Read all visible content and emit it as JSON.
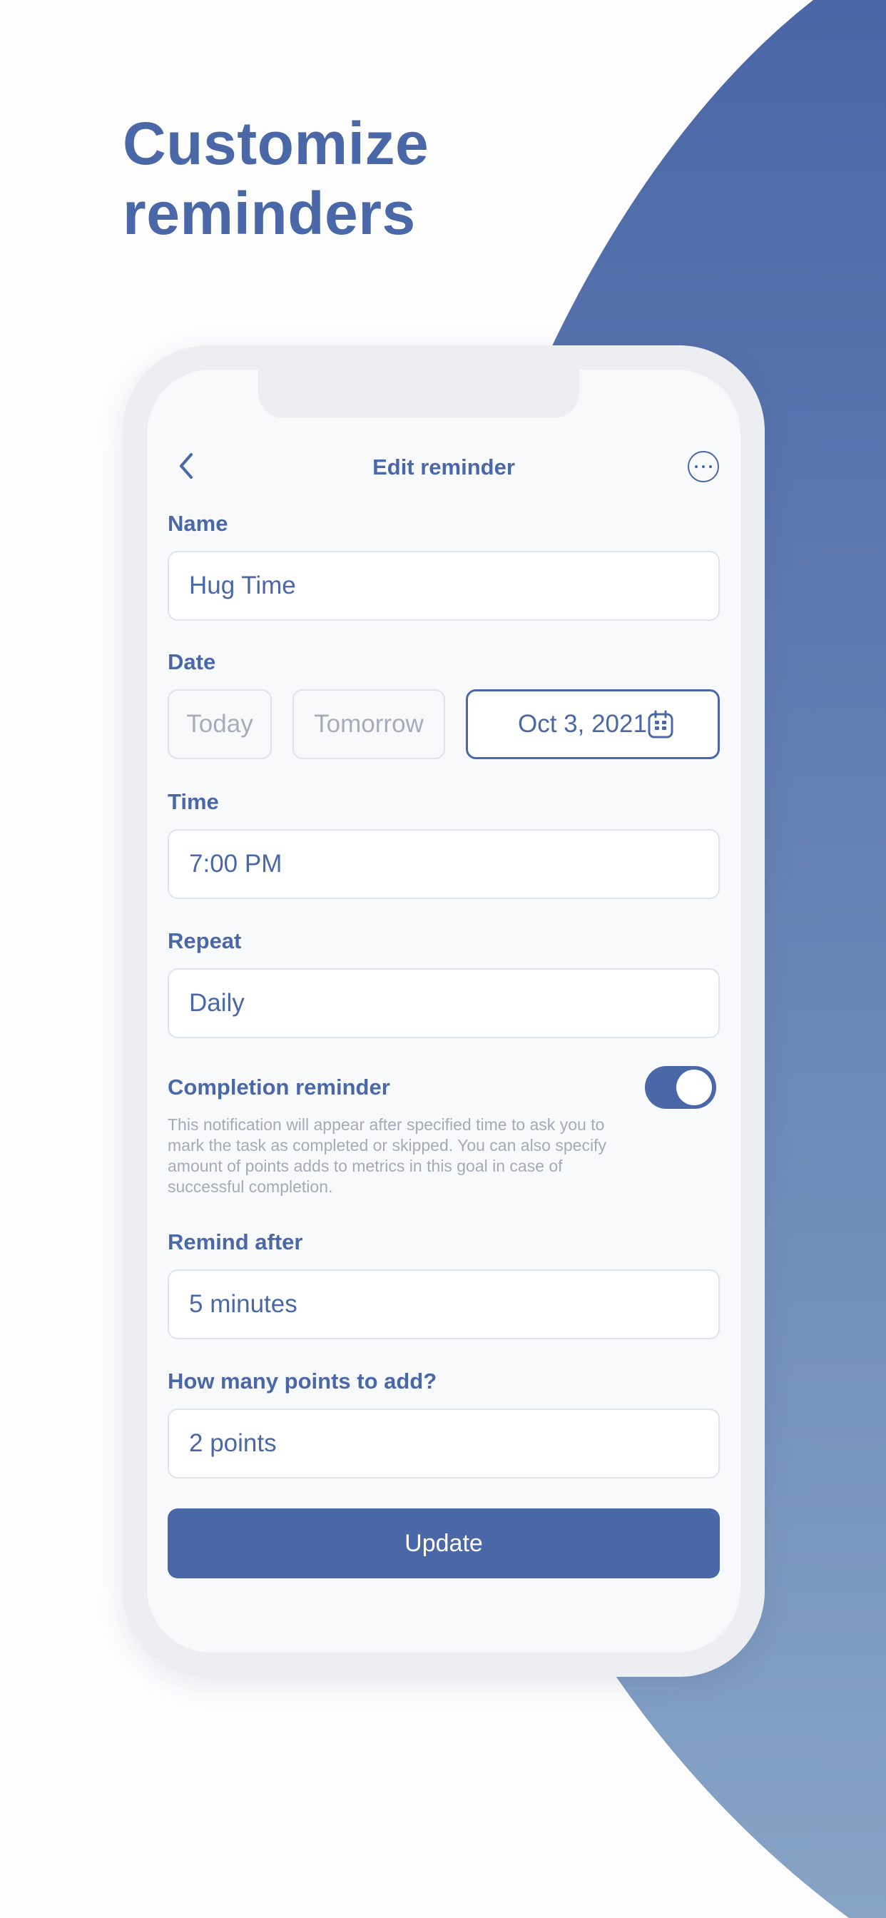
{
  "headline": {
    "line1": "Customize",
    "line2": "reminders"
  },
  "colors": {
    "accent": "#4a67a7",
    "muted_text": "#a4abb6",
    "border": "#dfe3ea"
  },
  "nav": {
    "title": "Edit reminder",
    "back_icon": "chevron-left-icon",
    "more_icon": "more-horizontal-icon"
  },
  "name": {
    "label": "Name",
    "value": "Hug Time"
  },
  "date": {
    "label": "Date",
    "options": [
      "Today",
      "Tomorrow"
    ],
    "selected": "Oct 3, 2021",
    "selected_icon": "calendar-icon"
  },
  "time": {
    "label": "Time",
    "value": "7:00 PM"
  },
  "repeat": {
    "label": "Repeat",
    "value": "Daily"
  },
  "completion": {
    "label": "Completion reminder",
    "enabled": true,
    "helper": "This notification will appear after specified time to ask you to mark the task as completed or skipped. You can also specify amount of points adds to metrics in this goal in case of successful completion."
  },
  "remind_after": {
    "label": "Remind after",
    "value": "5 minutes"
  },
  "points": {
    "label": "How many points to add?",
    "value": "2 points"
  },
  "update_button": {
    "label": "Update"
  }
}
